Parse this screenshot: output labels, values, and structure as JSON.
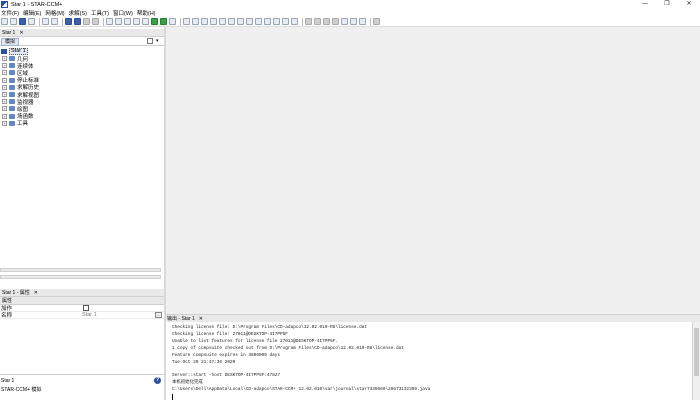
{
  "window": {
    "title": "Star 1 - STAR-CCM+",
    "controls": [
      "—",
      "❐",
      "✕"
    ]
  },
  "menu": [
    "文件(F)",
    "编辑(E)",
    "网格(M)",
    "求解(S)",
    "工具(T)",
    "窗口(W)",
    "帮助(H)"
  ],
  "sim_panel": {
    "header": "Star 1",
    "close": "✕",
    "tab": "模拟",
    "tree_root": "Star 1",
    "tree_items": [
      "几何",
      "连续体",
      "区域",
      "停止标准",
      "求解历史",
      "求解视图",
      "监视器",
      "绘图",
      "场函数",
      "工具"
    ]
  },
  "properties_panel": {
    "header": "Star 1 - 属性",
    "close": "✕",
    "section": "属性",
    "rows": [
      {
        "name": "加作",
        "value": ""
      },
      {
        "name": "名称",
        "value": "Star 1"
      }
    ]
  },
  "help_box": {
    "title": "Star 1",
    "subtitle": "STAR-CCM+ 模拟",
    "icon": "?"
  },
  "output": {
    "header": "输出 - Star 1",
    "close": "✕",
    "lines": [
      "Checking license file: D:\\Program Files\\CD-adapco\\12.02.010-R8\\license.dat",
      "Checking license file: 27011@DESKTOP-4I7PP5F",
      "Unable to list features for license file 27011@DESKTOP-4I7PP5F.",
      "1 copy of ccmpsuite checked out from D:\\Program Files\\CD-adapco\\12.02.010-R8\\license.dat",
      "Feature ccmpsuite expires in 3800000 days",
      "Tue Oct 20 21:47:36 2020",
      "",
      "Server::start -host DESKTOP-4I7PP5F:47827",
      "本机初始化完成",
      "C:\\Users\\Dell\\AppData\\Local\\CD-adapco\\STAR-CCM+ 12.02.010\\var\\journal\\star7339669\\28673132399.java"
    ]
  }
}
